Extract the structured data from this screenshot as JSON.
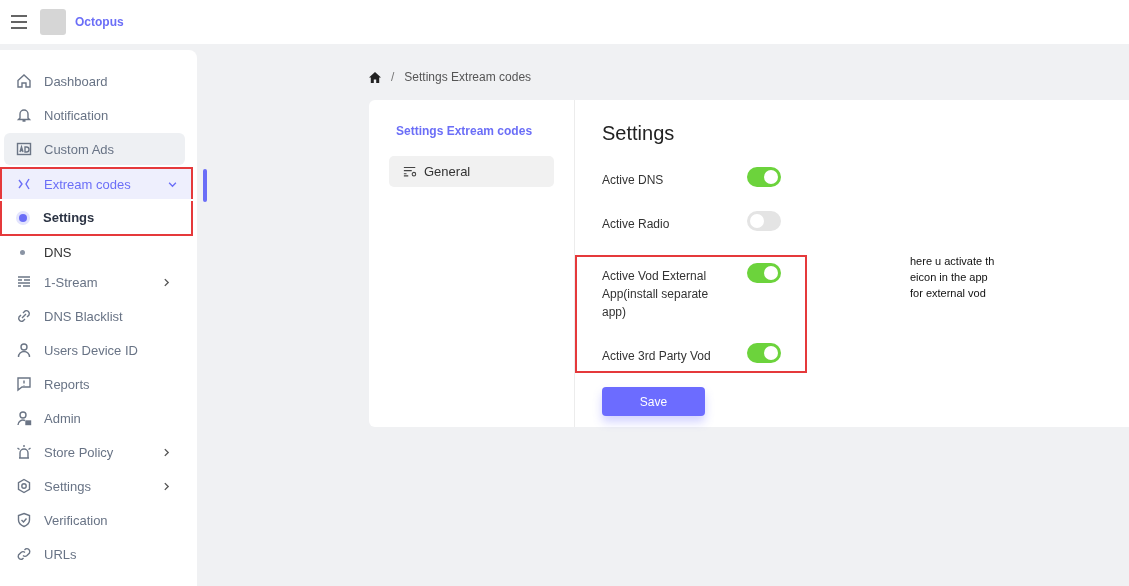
{
  "app": {
    "name": "Octopus"
  },
  "sidebar": {
    "items": [
      {
        "label": "Dashboard",
        "selected": false,
        "hovered": false,
        "expandable": false,
        "highlighted": false
      },
      {
        "label": "Notification",
        "selected": false,
        "hovered": false,
        "expandable": false,
        "highlighted": false
      },
      {
        "label": "Custom Ads",
        "selected": false,
        "hovered": true,
        "expandable": false,
        "highlighted": false
      },
      {
        "label": "Extream codes",
        "selected": true,
        "hovered": false,
        "expandable": true,
        "expanded": true,
        "highlighted": true,
        "children": [
          {
            "label": "Settings",
            "selected": true,
            "highlighted": true
          },
          {
            "label": "DNS",
            "selected": false,
            "highlighted": false
          }
        ]
      },
      {
        "label": "1-Stream",
        "selected": false,
        "hovered": false,
        "expandable": true,
        "expanded": false,
        "highlighted": false
      },
      {
        "label": "DNS Blacklist",
        "selected": false,
        "hovered": false,
        "expandable": false,
        "highlighted": false
      },
      {
        "label": "Users Device ID",
        "selected": false,
        "hovered": false,
        "expandable": false,
        "highlighted": false
      },
      {
        "label": "Reports",
        "selected": false,
        "hovered": false,
        "expandable": false,
        "highlighted": false
      },
      {
        "label": "Admin",
        "selected": false,
        "hovered": false,
        "expandable": false,
        "highlighted": false
      },
      {
        "label": "Store Policy",
        "selected": false,
        "hovered": false,
        "expandable": true,
        "expanded": false,
        "highlighted": false
      },
      {
        "label": "Settings",
        "selected": false,
        "hovered": false,
        "expandable": true,
        "expanded": false,
        "highlighted": false
      },
      {
        "label": "Verification",
        "selected": false,
        "hovered": false,
        "expandable": false,
        "highlighted": false
      },
      {
        "label": "URLs",
        "selected": false,
        "hovered": false,
        "expandable": false,
        "highlighted": false
      }
    ]
  },
  "breadcrumb": {
    "separator": "/",
    "current": "Settings Extream codes"
  },
  "settings_nav": {
    "title": "Settings Extream codes",
    "items": [
      {
        "label": "General",
        "selected": true
      }
    ]
  },
  "settings": {
    "title": "Settings",
    "rows": [
      {
        "label": "Active DNS",
        "on": true,
        "highlighted": false
      },
      {
        "label": "Active Radio",
        "on": false,
        "highlighted": false
      },
      {
        "label": "Active Vod External App(install separate app)",
        "on": true,
        "highlighted": true
      },
      {
        "label": "Active 3rd Party Vod",
        "on": true,
        "highlighted": true
      }
    ],
    "save_button": "Save",
    "note": "here u activate th\neicon in the app\nfor external vod"
  }
}
